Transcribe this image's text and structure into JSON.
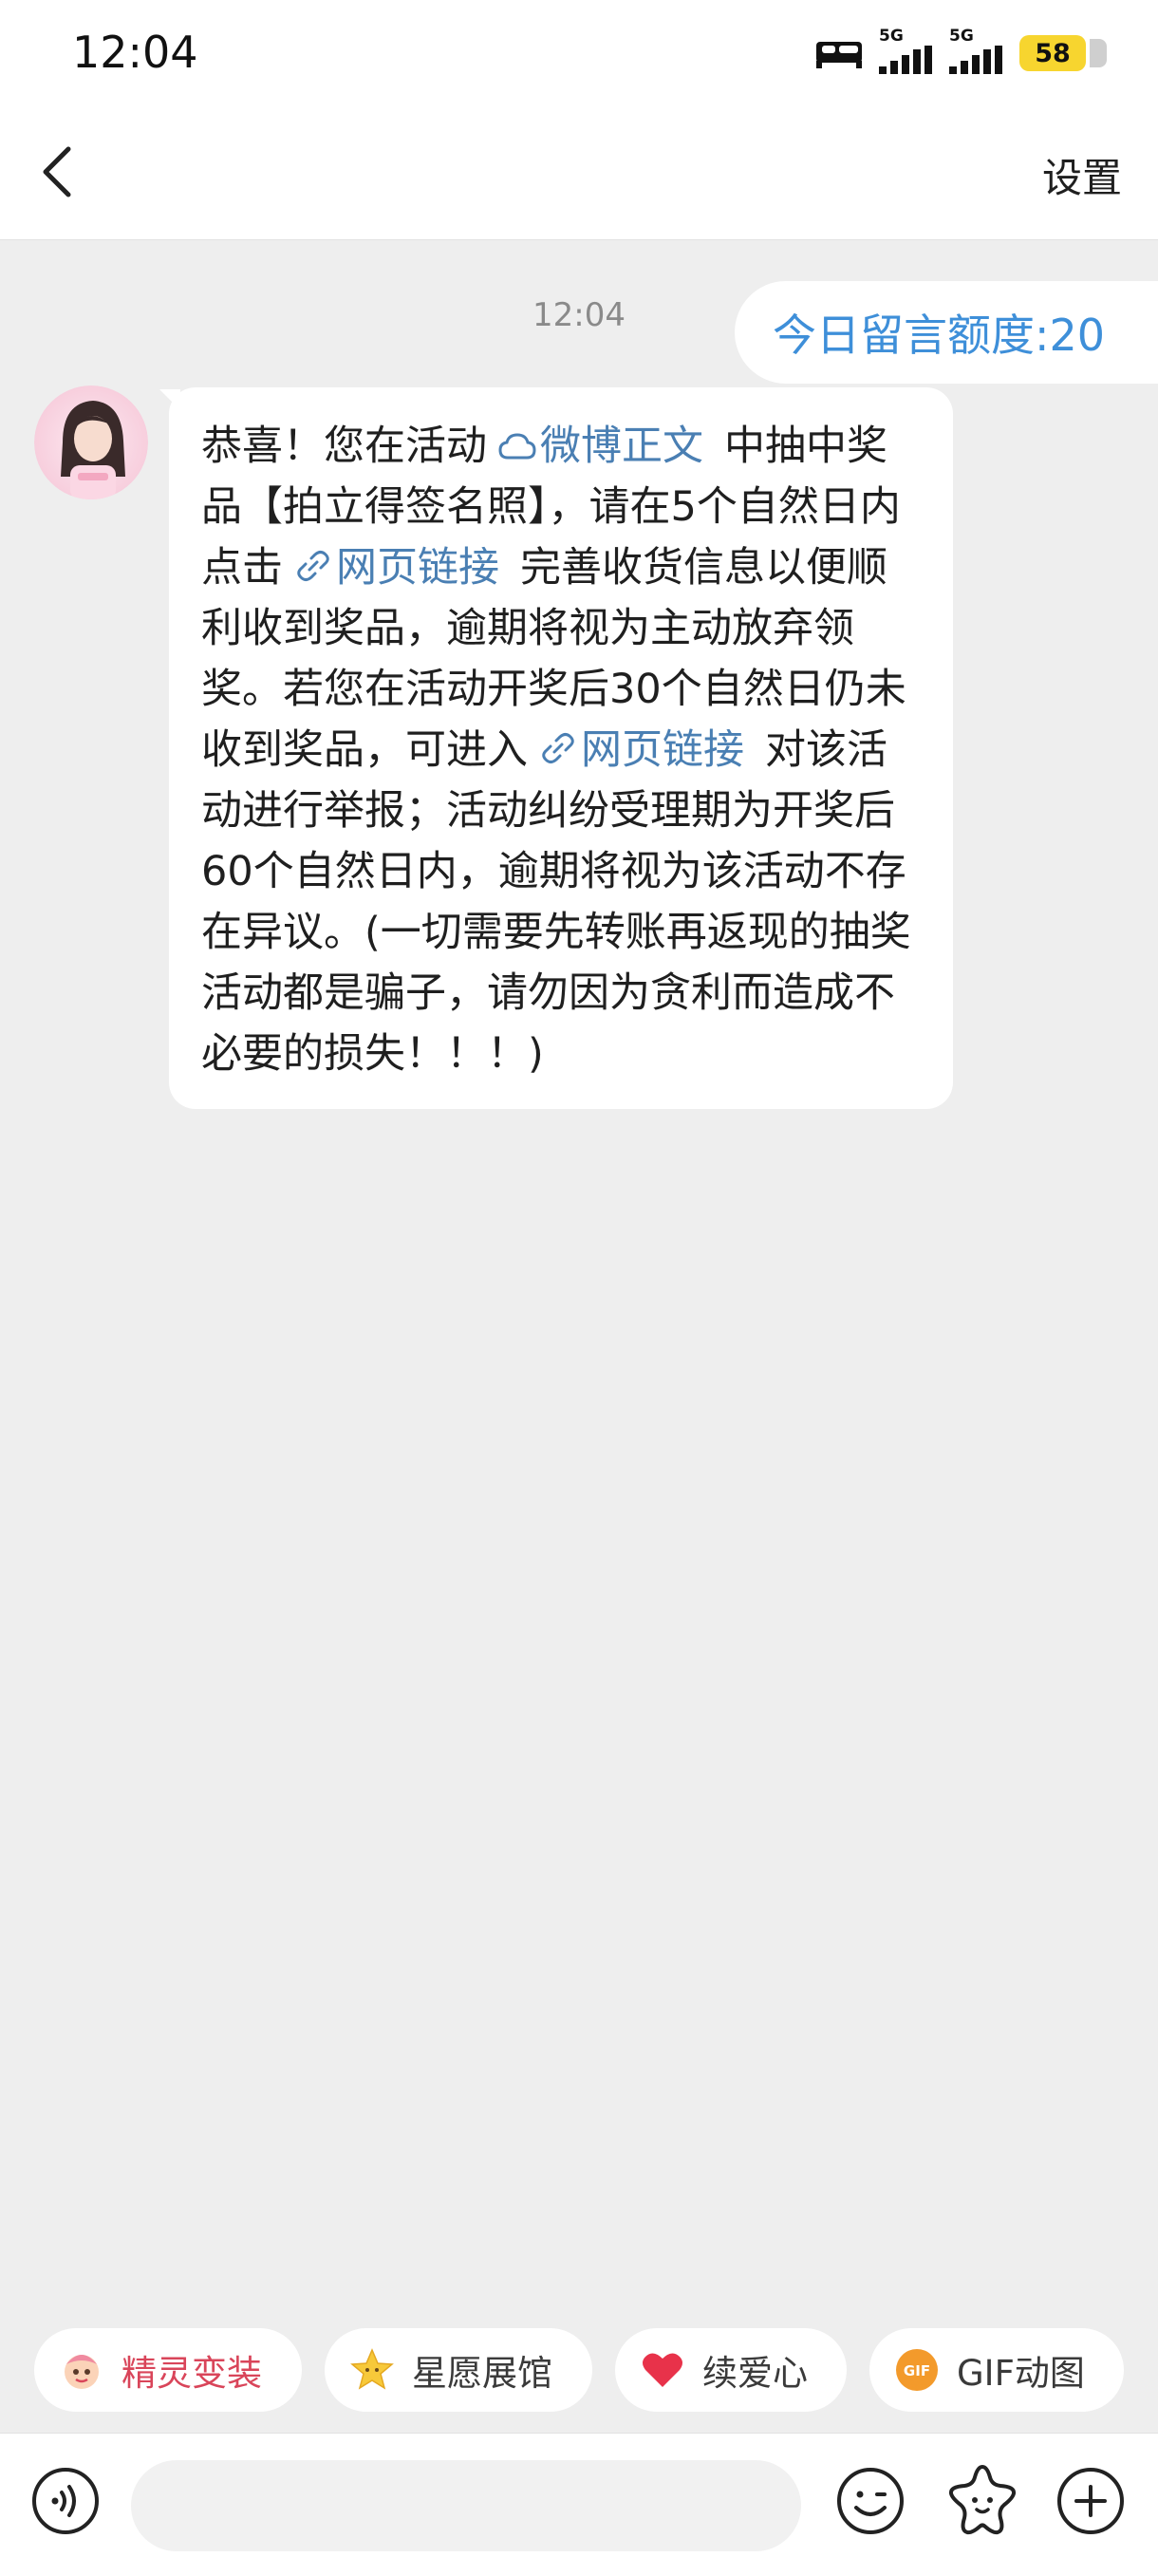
{
  "status_bar": {
    "time": "12:04",
    "network1": "5G",
    "network2": "5G",
    "battery": "58"
  },
  "nav": {
    "title": "",
    "settings_label": "设置"
  },
  "chat": {
    "timestamp": "12:04",
    "quota_label": "今日留言额度:20",
    "message": {
      "part1": "恭喜！您在活动",
      "link1": "微博正文",
      "part2": "中抽中奖品【拍立得签名照】，请在5个自然日内点击",
      "link2": "网页链接",
      "part3": "完善收货信息以便顺利收到奖品，逾期将视为主动放弃领奖。若您在活动开奖后30个自然日仍未收到奖品，可进入",
      "link3": "网页链接",
      "part4": "对该活动进行举报；活动纠纷受理期为开奖后60个自然日内，逾期将视为该活动不存在异议。(一切需要先转账再返现的抽奖活动都是骗子，请勿因为贪利而造成不必要的损失！！！)"
    }
  },
  "quick_actions": [
    {
      "label": "精灵变装",
      "icon": "sprite-icon"
    },
    {
      "label": "星愿展馆",
      "icon": "star-icon"
    },
    {
      "label": "续爱心",
      "icon": "heart-icon"
    },
    {
      "label": "GIF动图",
      "icon": "gif-icon"
    }
  ],
  "input_bar": {
    "placeholder": ""
  },
  "colors": {
    "link": "#4a7fb3",
    "quota": "#3e8fd9",
    "chip_highlight": "#d9455a",
    "background": "#eeeeee"
  }
}
